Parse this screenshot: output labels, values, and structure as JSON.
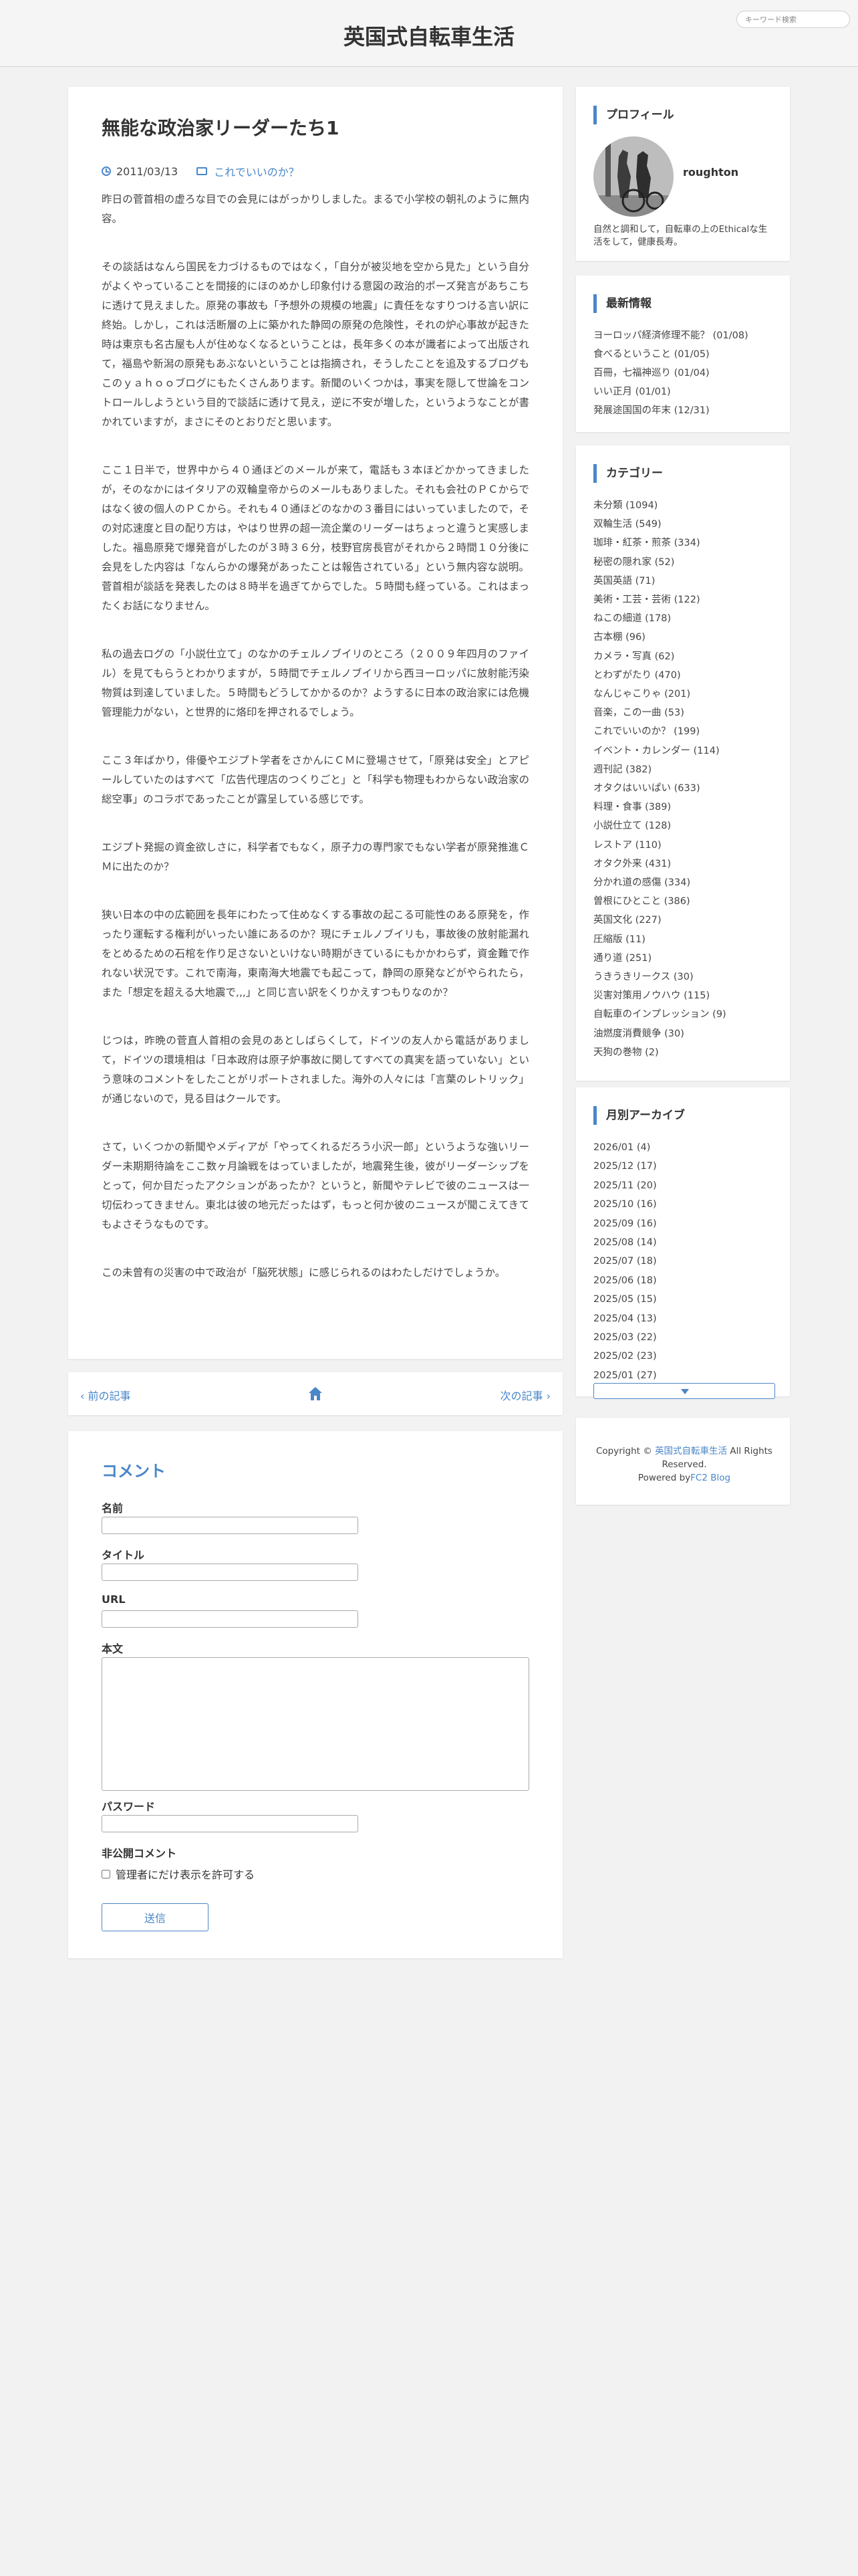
{
  "site": {
    "title": "英国式自転車生活",
    "search_placeholder": "キーワード検索"
  },
  "entry": {
    "title": "無能な政治家リーダーたち1",
    "date": "2011/03/13",
    "category": "これでいいのか？",
    "paragraphs": [
      "昨日の菅首相の虚ろな目での会見にはがっかりしました。まるで小学校の朝礼のように無内容。",
      "その談話はなんら国民を力づけるものではなく，「自分が被災地を空から見た」という自分がよくやっていることを間接的にほのめかし印象付ける意図の政治的ポーズ発言があちこちに透けて見えました。原発の事故も「予想外の規模の地震」に責任をなすりつける言い訳に終始。しかし，これは活断層の上に築かれた静岡の原発の危険性，それの炉心事故が起きた時は東京も名古屋も人が住めなくなるということは，長年多くの本が識者によって出版されて，福島や新潟の原発もあぶないということは指摘され，そうしたことを追及するブログもこのｙａｈｏｏブログにもたくさんあります。新聞のいくつかは，事実を隠して世論をコントロールしようという目的で談話に透けて見え，逆に不安が増した，というようなことが書かれていますが，まさにそのとおりだと思います。",
      "ここ１日半で，世界中から４０通ほどのメールが来て，電話も３本ほどかかってきましたが，そのなかにはイタリアの双輪皇帝からのメールもありました。それも会社のＰＣからではなく彼の個人のＰＣから。それも４０通ほどのなかの３番目にはいっていましたので，その対応速度と目の配り方は，やはり世界の超一流企業のリーダーはちょっと違うと実感しました。福島原発で爆発音がしたのが３時３６分，枝野官房長官がそれから２時間１０分後に会見をした内容は「なんらかの爆発があったことは報告されている」という無内容な説明。菅首相が談話を発表したのは８時半を過ぎてからでした。５時間も経っている。これはまったくお話になりません。",
      "私の過去ログの「小説仕立て」のなかのチェルノブイリのところ（２００９年四月のファイル）を見てもらうとわかりますが，５時間でチェルノブイリから西ヨーロッパに放射能汚染物質は到達していました。５時間もどうしてかかるのか？ようするに日本の政治家には危機管理能力がない，と世界的に烙印を押されるでしょう。",
      "ここ３年ばかり，俳優やエジプト学者をさかんにＣＭに登場させて，「原発は安全」とアピールしていたのはすべて「広告代理店のつくりごと」と「科学も物理もわからない政治家の総空事」のコラボであったことが露呈している感じです。",
      "エジプト発掘の資金欲しさに，科学者でもなく，原子力の専門家でもない学者が原発推進ＣＭに出たのか？",
      "狭い日本の中の広範囲を長年にわたって住めなくする事故の起こる可能性のある原発を，作ったり運転する権利がいったい誰にあるのか？現にチェルノブイリも，事故後の放射能漏れをとめるための石棺を作り足さないといけない時期がきているにもかかわらず，資金難で作れない状況です。これで南海，東南海大地震でも起こって，静岡の原発などがやられたら，また「想定を超える大地震で,,,」と同じ言い訳をくりかえすつもりなのか？",
      "じつは，昨晩の菅直人首相の会見のあとしばらくして，ドイツの友人から電話がありまして，ドイツの環境相は「日本政府は原子炉事故に関してすべての真実を語っていない」という意味のコメントをしたことがリポートされました。海外の人々には「言葉のレトリック」が通じないので，見る目はクールです。",
      "さて，いくつかの新聞やメディアが「やってくれるだろう小沢一郎」というような強いリーダー未期期待論をここ数ヶ月論戦をはっていましたが，地震発生後，彼がリーダーシップをとって，何か目だったアクションがあったか？というと，新聞やテレビで彼のニュースは一切伝わってきません。東北は彼の地元だったはず，もっと何か彼のニュースが聞こえてきてもよさそうなものです。",
      "この未曾有の災害の中で政治が「脳死状態」に感じられるのはわたしだけでしょうか。"
    ]
  },
  "pager": {
    "prev": "‹ 前の記事",
    "next": "次の記事 ›"
  },
  "comment": {
    "heading": "コメント",
    "name_label": "名前",
    "title_label": "タイトル",
    "url_label": "URL",
    "body_label": "本文",
    "password_label": "パスワード",
    "secret_label": "非公開コメント",
    "secret_check": "管理者にだけ表示を許可する",
    "submit": "送信"
  },
  "sidebar": {
    "profile": {
      "heading": "プロフィール",
      "username": "roughton",
      "intro": "自然と調和して，自転車の上のEthicalな生活をして，健康長寿。"
    },
    "recent": {
      "heading": "最新情報",
      "items": [
        "ヨーロッパ経済修理不能？ (01/08)",
        "食べるということ (01/05)",
        "百冊，七福神巡り (01/04)",
        "いい正月 (01/01)",
        "発展途国国の年末 (12/31)"
      ]
    },
    "category": {
      "heading": "カテゴリー",
      "items": [
        "未分類 (1094)",
        "双輪生活 (549)",
        "珈琲・紅茶・煎茶 (334)",
        "秘密の隠れ家 (52)",
        "英国英語 (71)",
        "美術・工芸・芸術 (122)",
        "ねこの細道 (178)",
        "古本棚 (96)",
        "カメラ・写真 (62)",
        "とわずがたり (470)",
        "なんじゃこりゃ (201)",
        "音楽，この一曲 (53)",
        "これでいいのか？ (199)",
        "イベント・カレンダー (114)",
        "週刊記 (382)",
        "オタクはいいぱい (633)",
        "料理・食事 (389)",
        "小説仕立て (128)",
        "レストア (110)",
        "オタク外来 (431)",
        "分かれ道の感傷 (334)",
        "曽根にひとこと (386)",
        "英国文化 (227)",
        "圧縮版 (11)",
        "通り道 (251)",
        "うきうきリークス (30)",
        "災害対策用ノウハウ (115)",
        "自転車のインプレッション (9)",
        "油燃度消費競争 (30)",
        "天狗の巻物 (2)"
      ]
    },
    "archive": {
      "heading": "月別アーカイブ",
      "items": [
        "2026/01 (4)",
        "2025/12 (17)",
        "2025/11 (20)",
        "2025/10 (16)",
        "2025/09 (16)",
        "2025/08 (14)",
        "2025/07 (18)",
        "2025/06 (18)",
        "2025/05 (15)",
        "2025/04 (13)",
        "2025/03 (22)",
        "2025/02 (23)",
        "2025/01 (27)"
      ]
    },
    "footer": {
      "copyright_prefix": "Copyright ©",
      "site_link": "英国式自転車生活",
      "rights": "All Rights Reserved.",
      "powered_prefix": "Powered by",
      "powered_link": "FC2 Blog"
    }
  },
  "colors": {
    "accent": "#4a86c8",
    "background": "#f2f2f2"
  }
}
